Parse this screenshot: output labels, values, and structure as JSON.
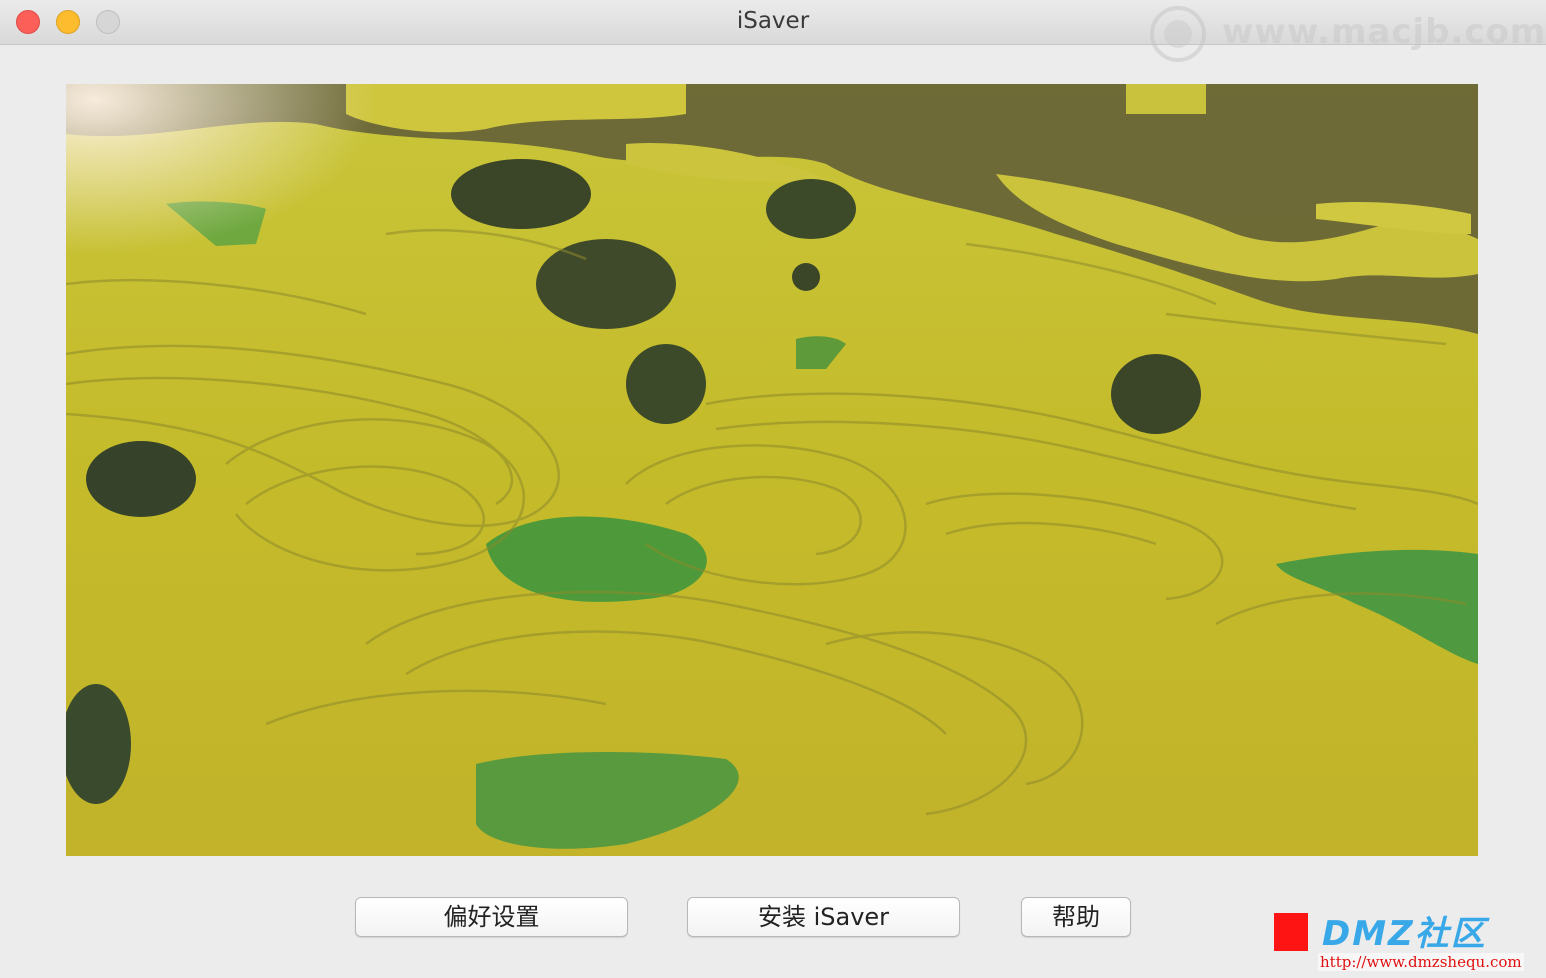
{
  "window": {
    "title": "iSaver"
  },
  "watermark": {
    "site": "www.macjb.com"
  },
  "preview": {
    "description_icon": "terraced-rapeseed-fields-image"
  },
  "buttons": {
    "preferences": "偏好设置",
    "install": "安装 iSaver",
    "help": "帮助"
  },
  "badge": {
    "name": "DMZ社区",
    "url": "http://www.dmzshequ.com"
  },
  "colors": {
    "close": "#fc5f57",
    "minimize": "#fdbc2e",
    "zoom": "#d6d6d6"
  }
}
